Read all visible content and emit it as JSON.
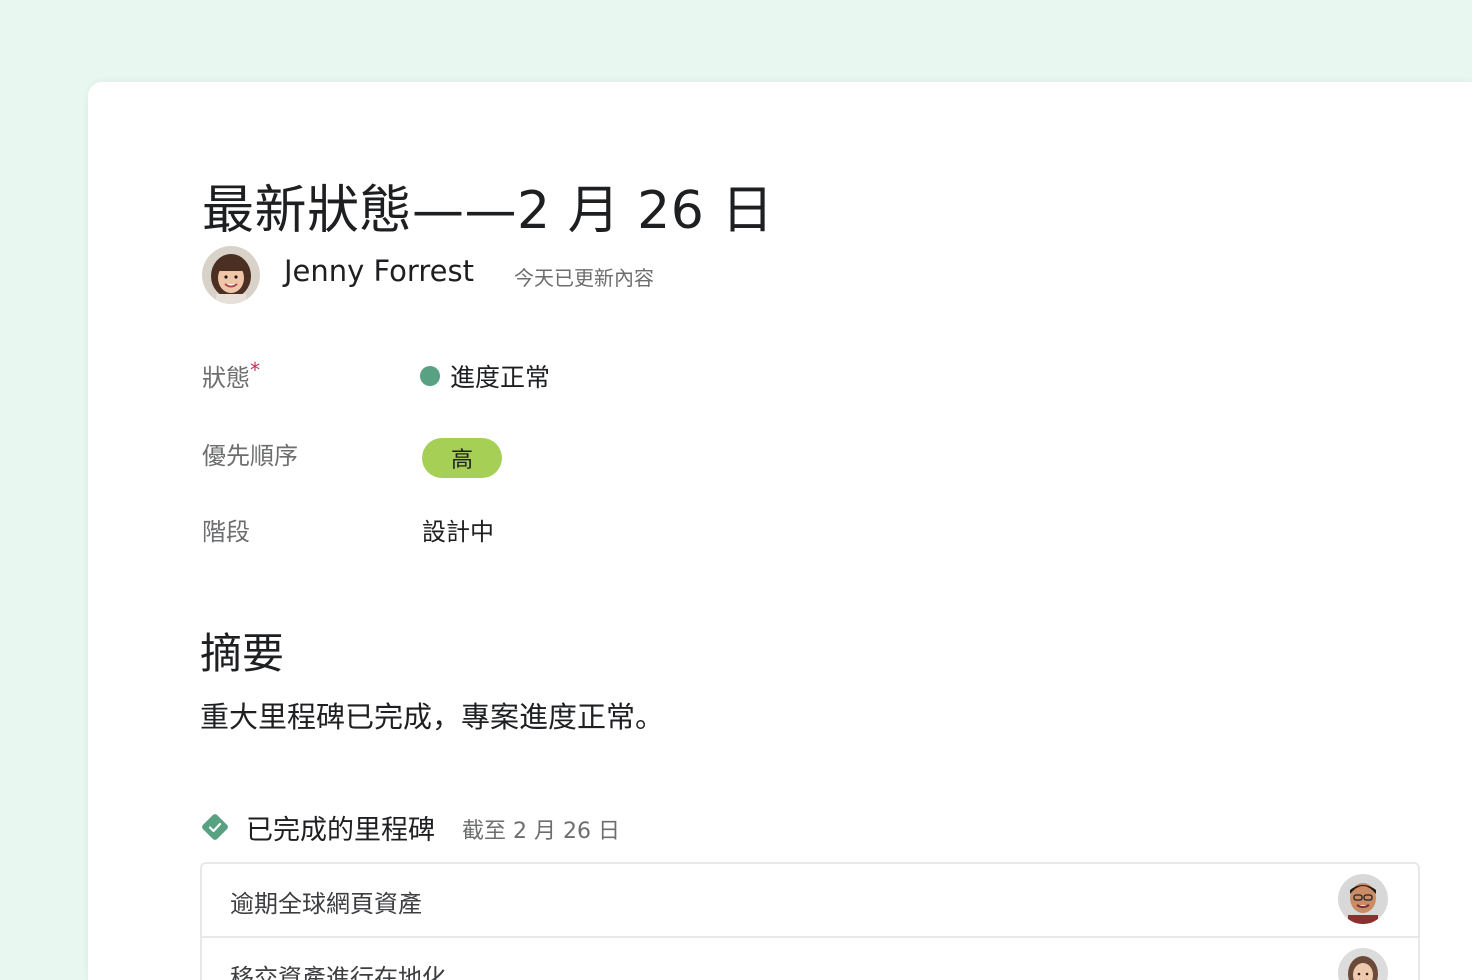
{
  "update": {
    "title": "最新狀態——2 月 26 日",
    "author": "Jenny Forrest",
    "updated_text": "今天已更新內容"
  },
  "fields": {
    "status_label": "狀態",
    "status_required_mark": "*",
    "status_value": "進度正常",
    "status_color": "#58a182",
    "priority_label": "優先順序",
    "priority_value": "高",
    "priority_color": "#a5cf55",
    "stage_label": "階段",
    "stage_value": "設計中"
  },
  "summary": {
    "heading": "摘要",
    "text": "重大里程碑已完成，專案進度正常。"
  },
  "milestones": {
    "heading": "已完成的里程碑",
    "date": "截至 2 月 26 日",
    "icon": "diamond-check-icon",
    "items": [
      {
        "label": "逾期全球網頁資產"
      },
      {
        "label": "移交資產進行在地化"
      }
    ]
  }
}
